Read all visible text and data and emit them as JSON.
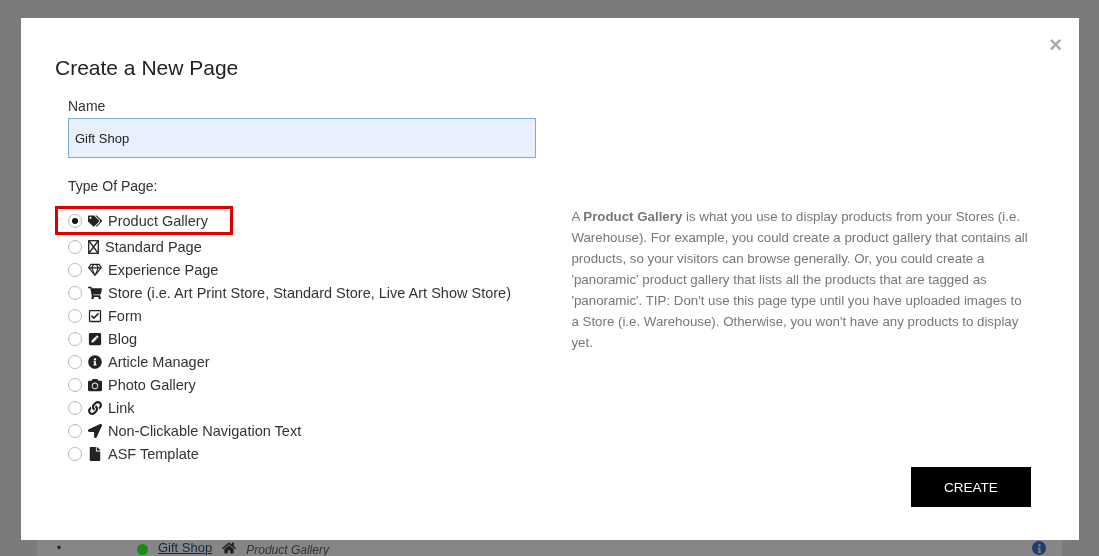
{
  "background_row": {
    "bullet": "•",
    "color": "#1a8a1a",
    "link": "Gift Shop",
    "type": "Product Gallery"
  },
  "modal": {
    "title": "Create a New Page",
    "close": "×",
    "name_field": {
      "label": "Name",
      "value": "Gift Shop"
    },
    "type_label": "Type Of Page:",
    "page_types": [
      {
        "label": "Product Gallery",
        "selected": true
      },
      {
        "label": "Standard Page",
        "selected": false
      },
      {
        "label": "Experience Page",
        "selected": false
      },
      {
        "label": "Store (i.e. Art Print Store, Standard Store, Live Art Show Store)",
        "selected": false
      },
      {
        "label": "Form",
        "selected": false
      },
      {
        "label": "Blog",
        "selected": false
      },
      {
        "label": "Article Manager",
        "selected": false
      },
      {
        "label": "Photo Gallery",
        "selected": false
      },
      {
        "label": "Link",
        "selected": false
      },
      {
        "label": "Non-Clickable Navigation Text",
        "selected": false
      },
      {
        "label": "ASF Template",
        "selected": false
      }
    ],
    "description": "A **Product Gallery** is what you use to display products from your Stores (i.e. Warehouse). For example, you could create a product gallery that contains all products, so your visitors can browse generally. Or, you could create a 'panoramic' product gallery that lists all the products that are tagged as 'panoramic'. TIP: Don't use this page type until you have uploaded images to a Store (i.e. Warehouse). Otherwise, you won't have any products to display yet.",
    "create_button": "CREATE"
  }
}
